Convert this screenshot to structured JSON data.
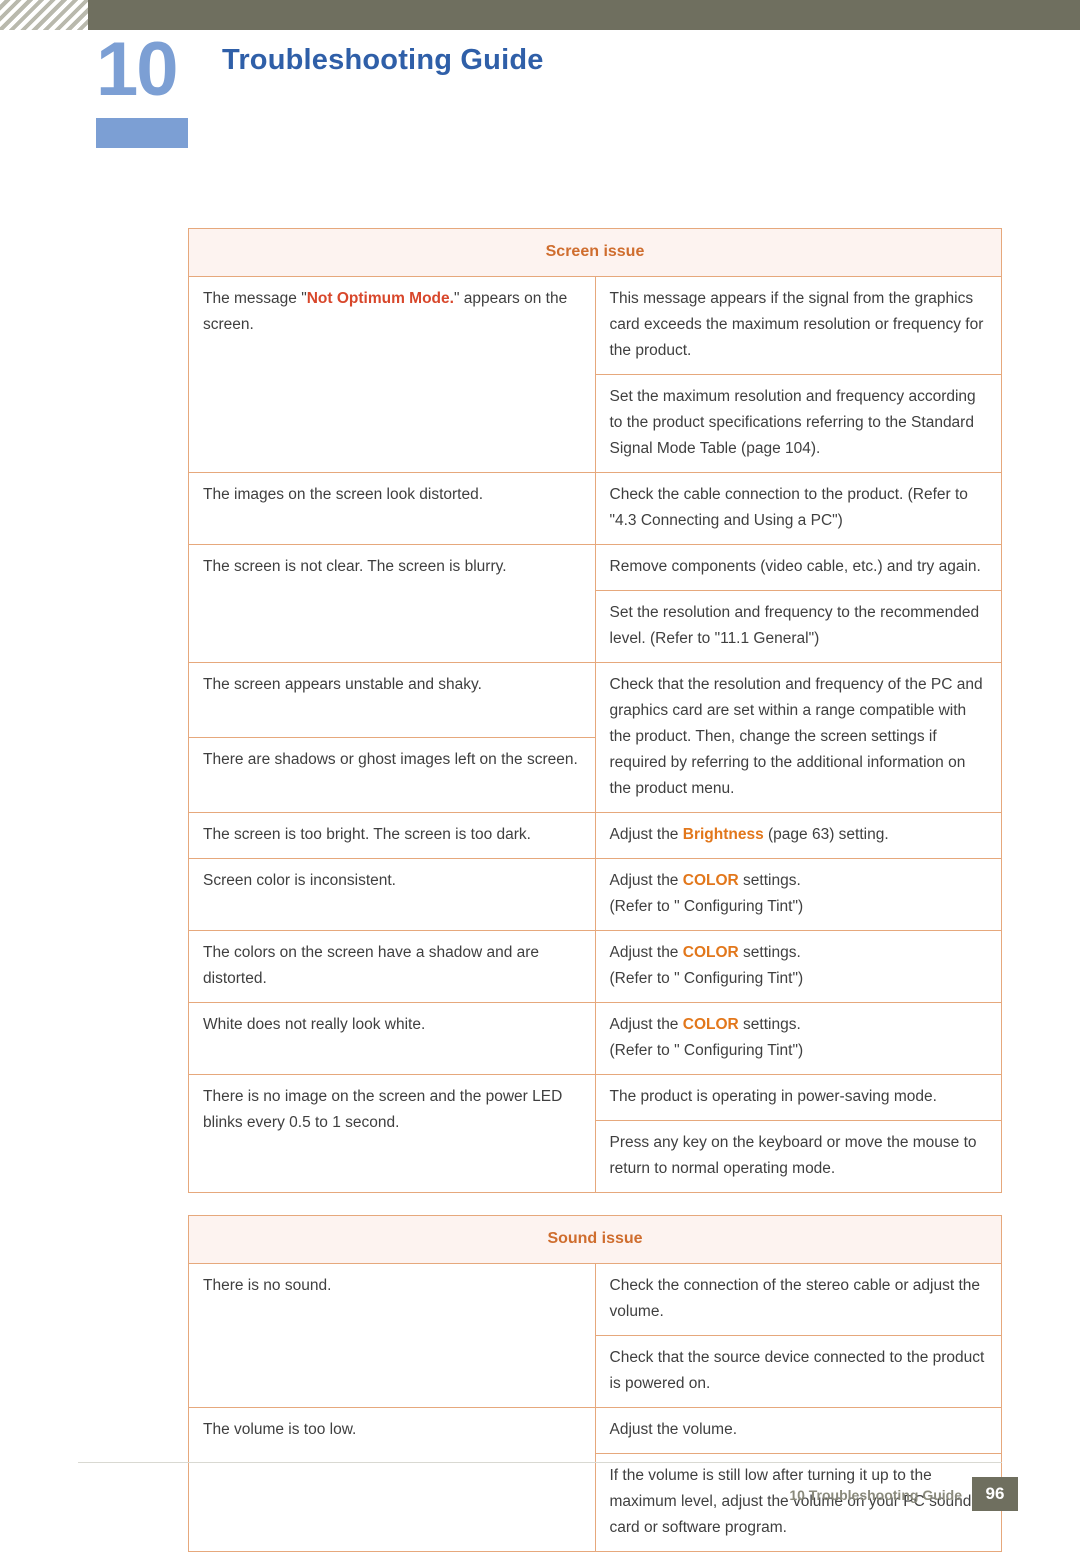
{
  "header": {
    "chapter_number": "10",
    "title": "Troubleshooting Guide"
  },
  "sections": [
    {
      "heading": "Screen issue",
      "rows": [
        {
          "left": "The message \"Not Optimum Mode.\" appears on the screen.",
          "left_parts": [
            {
              "text": "The message \"",
              "style": "plain"
            },
            {
              "text": "Not Optimum Mode.",
              "style": "red"
            },
            {
              "text": "\" appears on the screen.",
              "style": "plain"
            }
          ],
          "right": "This message appears if the signal from the graphics card exceeds the maximum resolution or frequency for the product."
        },
        {
          "left": "",
          "right": "Set the maximum resolution and frequency according to the product specifications referring to the Standard Signal Mode Table (page 104)."
        },
        {
          "left": "The images on the screen look distorted.",
          "right": "Check the cable connection to the product. (Refer to \"4.3 Connecting and Using a PC\")"
        },
        {
          "left": "The screen is not clear. The screen is blurry.",
          "right": "Remove components (video cable, etc.) and try again."
        },
        {
          "left": "",
          "right": "Set the resolution and frequency to the recommended level. (Refer to \"11.1 General\")"
        },
        {
          "left": "The screen appears unstable and shaky.",
          "right": "Check that the resolution and frequency of the PC and graphics card are set within a range compatible with the product. Then, change the screen settings if required by referring to the additional information on the product menu."
        },
        {
          "left": "There are shadows or ghost images left on the screen.",
          "right": ""
        },
        {
          "left": "The screen is too bright. The screen is too dark.",
          "right_parts": [
            {
              "text": "Adjust the ",
              "style": "plain"
            },
            {
              "text": "Brightness",
              "style": "orange"
            },
            {
              "text": " (page 63) setting.",
              "style": "plain"
            }
          ]
        },
        {
          "left": "Screen color is inconsistent.",
          "right_parts": [
            {
              "text": "Adjust the ",
              "style": "plain"
            },
            {
              "text": "COLOR",
              "style": "orange"
            },
            {
              "text": " settings.",
              "style": "plain"
            },
            {
              "text": "\n(Refer to \" Configuring Tint\")",
              "style": "plain"
            }
          ]
        },
        {
          "left": "The colors on the screen have a shadow and are distorted.",
          "right_parts": [
            {
              "text": "Adjust the ",
              "style": "plain"
            },
            {
              "text": "COLOR",
              "style": "orange"
            },
            {
              "text": " settings.",
              "style": "plain"
            },
            {
              "text": "\n(Refer to \" Configuring Tint\")",
              "style": "plain"
            }
          ]
        },
        {
          "left": "White does not really look white.",
          "right_parts": [
            {
              "text": "Adjust the ",
              "style": "plain"
            },
            {
              "text": "COLOR",
              "style": "orange"
            },
            {
              "text": " settings.",
              "style": "plain"
            },
            {
              "text": "\n(Refer to \" Configuring Tint\")",
              "style": "plain"
            }
          ]
        },
        {
          "left": "There is no image on the screen and the power LED blinks every 0.5 to 1 second.",
          "right": "The product is operating in power-saving mode."
        },
        {
          "left": "",
          "right": "Press any key on the keyboard or move the mouse to return to normal operating mode."
        }
      ]
    },
    {
      "heading": "Sound issue",
      "rows": [
        {
          "left": "There is no sound.",
          "right": "Check the connection of the stereo cable or adjust the volume."
        },
        {
          "left": "",
          "right": "Check that the source device connected to the product is powered on."
        },
        {
          "left": "The volume is too low.",
          "right": "Adjust the volume."
        },
        {
          "left": "",
          "right": "If the volume is still low after turning it up to the maximum level, adjust the volume on your PC sound card or software program."
        }
      ]
    }
  ],
  "footer": {
    "text": "10 Troubleshooting Guide",
    "page": "96"
  },
  "colors": {
    "accent_blue": "#2f5fa8",
    "number_blue": "#7c9fd4",
    "table_border": "#e6a87c",
    "section_head_text": "#cf6d2e",
    "section_head_bg": "#fdf3f0",
    "highlight_red": "#d8472b",
    "highlight_orange": "#e2771b",
    "header_bar": "#6f6f5f"
  }
}
